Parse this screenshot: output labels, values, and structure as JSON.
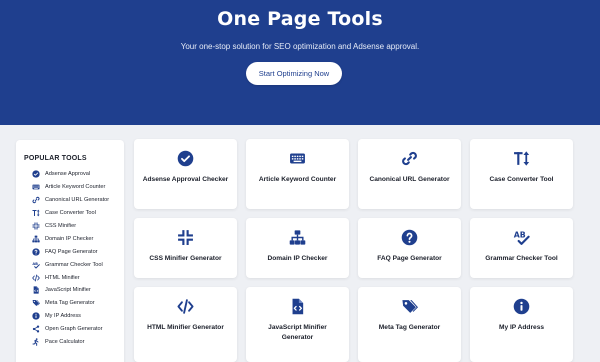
{
  "hero": {
    "title": "One Page Tools",
    "subtitle": "Your one-stop solution for SEO optimization and Adsense approval.",
    "cta_label": "Start Optimizing Now",
    "bg_color": "#1f3f8e"
  },
  "sidebar": {
    "heading": "POPULAR TOOLS",
    "items": [
      {
        "label": "Adsense Approval",
        "icon": "check-circle-icon"
      },
      {
        "label": "Article Keyword Counter",
        "icon": "keyboard-icon"
      },
      {
        "label": "Canonical URL Generator",
        "icon": "link-icon"
      },
      {
        "label": "Case Converter Tool",
        "icon": "text-height-icon"
      },
      {
        "label": "CSS Minifier",
        "icon": "compress-icon"
      },
      {
        "label": "Domain IP Checker",
        "icon": "network-icon"
      },
      {
        "label": "FAQ Page Generator",
        "icon": "question-circle-icon"
      },
      {
        "label": "Grammar Checker Tool",
        "icon": "spell-check-icon"
      },
      {
        "label": "HTML Minifier",
        "icon": "code-icon"
      },
      {
        "label": "JavaScript Minifier",
        "icon": "file-code-icon"
      },
      {
        "label": "Meta Tag Generator",
        "icon": "tags-icon"
      },
      {
        "label": "My IP Address",
        "icon": "info-circle-icon"
      },
      {
        "label": "Open Graph Generator",
        "icon": "share-icon"
      },
      {
        "label": "Pace Calculator",
        "icon": "running-icon"
      }
    ]
  },
  "cards": [
    {
      "title": "Adsense Approval Checker",
      "icon": "check-circle-icon"
    },
    {
      "title": "Article Keyword Counter",
      "icon": "keyboard-icon"
    },
    {
      "title": "Canonical URL Generator",
      "icon": "link-icon"
    },
    {
      "title": "Case Converter Tool",
      "icon": "text-height-icon"
    },
    {
      "title": "CSS Minifier Generator",
      "icon": "compress-icon"
    },
    {
      "title": "Domain IP Checker",
      "icon": "network-icon"
    },
    {
      "title": "FAQ Page Generator",
      "icon": "question-circle-icon"
    },
    {
      "title": "Grammar Checker Tool",
      "icon": "spell-check-icon"
    },
    {
      "title": "HTML Minifier Generator",
      "icon": "code-icon"
    },
    {
      "title": "JavaScript Minifier Generator",
      "icon": "file-code-icon"
    },
    {
      "title": "Meta Tag Generator",
      "icon": "tags-icon"
    },
    {
      "title": "My IP Address",
      "icon": "info-circle-icon"
    }
  ],
  "colors": {
    "accent": "#1f3f8e",
    "page_bg": "#eef0f4",
    "card_bg": "#ffffff"
  }
}
